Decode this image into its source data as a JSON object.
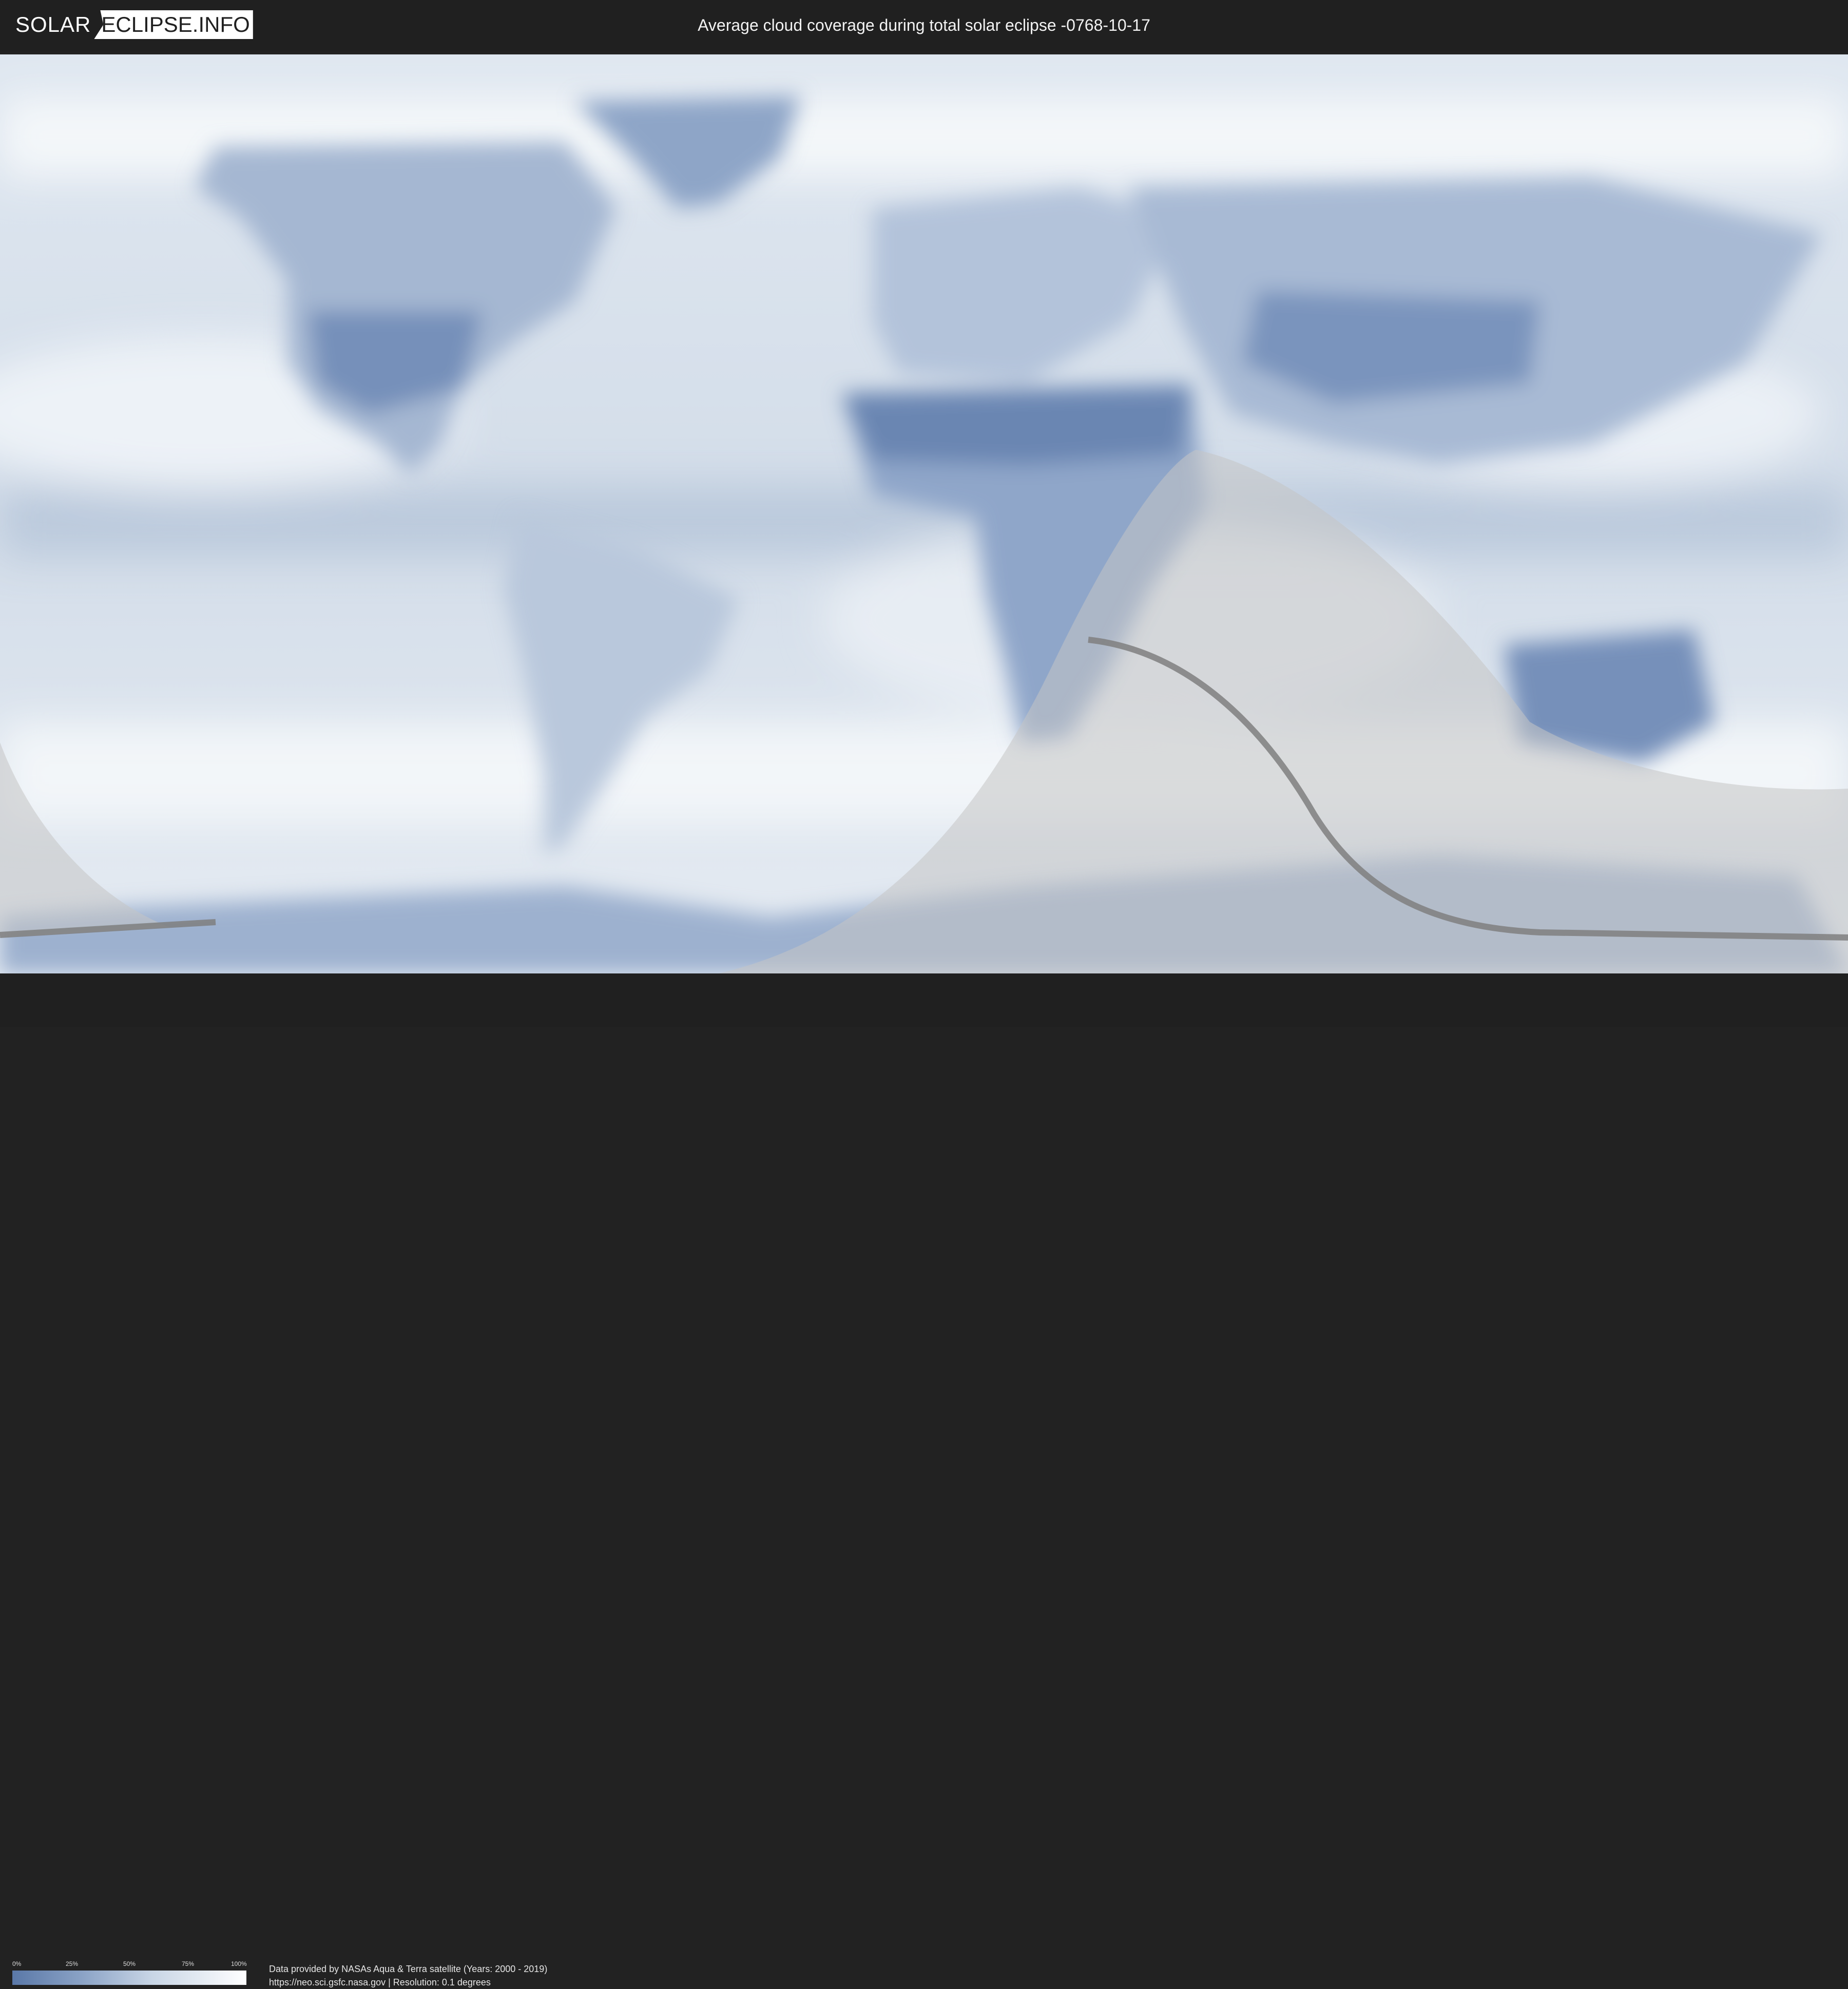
{
  "header": {
    "logo_part1": "SOLAR",
    "logo_part2": "ECLIPSE.INFO",
    "title": "Average cloud coverage during total solar eclipse -0768-10-17"
  },
  "legend": {
    "ticks": [
      "0%",
      "25%",
      "50%",
      "75%",
      "100%"
    ],
    "colors": {
      "low": "#5a78a8",
      "high": "#ffffff"
    }
  },
  "footer": {
    "credit_line1": "Data provided by NASAs Aqua & Terra satellite (Years: 2000 - 2019)",
    "credit_line2": "https://neo.sci.gsfc.nasa.gov | Resolution: 0.1 degrees"
  },
  "colors": {
    "background": "#202020",
    "ocean": "#cbd6e4",
    "land_dark": "#6f89b4",
    "cloud": "#f2f5f9",
    "eclipse_shadow": "#c8c8c8",
    "eclipse_path": "#808080"
  }
}
